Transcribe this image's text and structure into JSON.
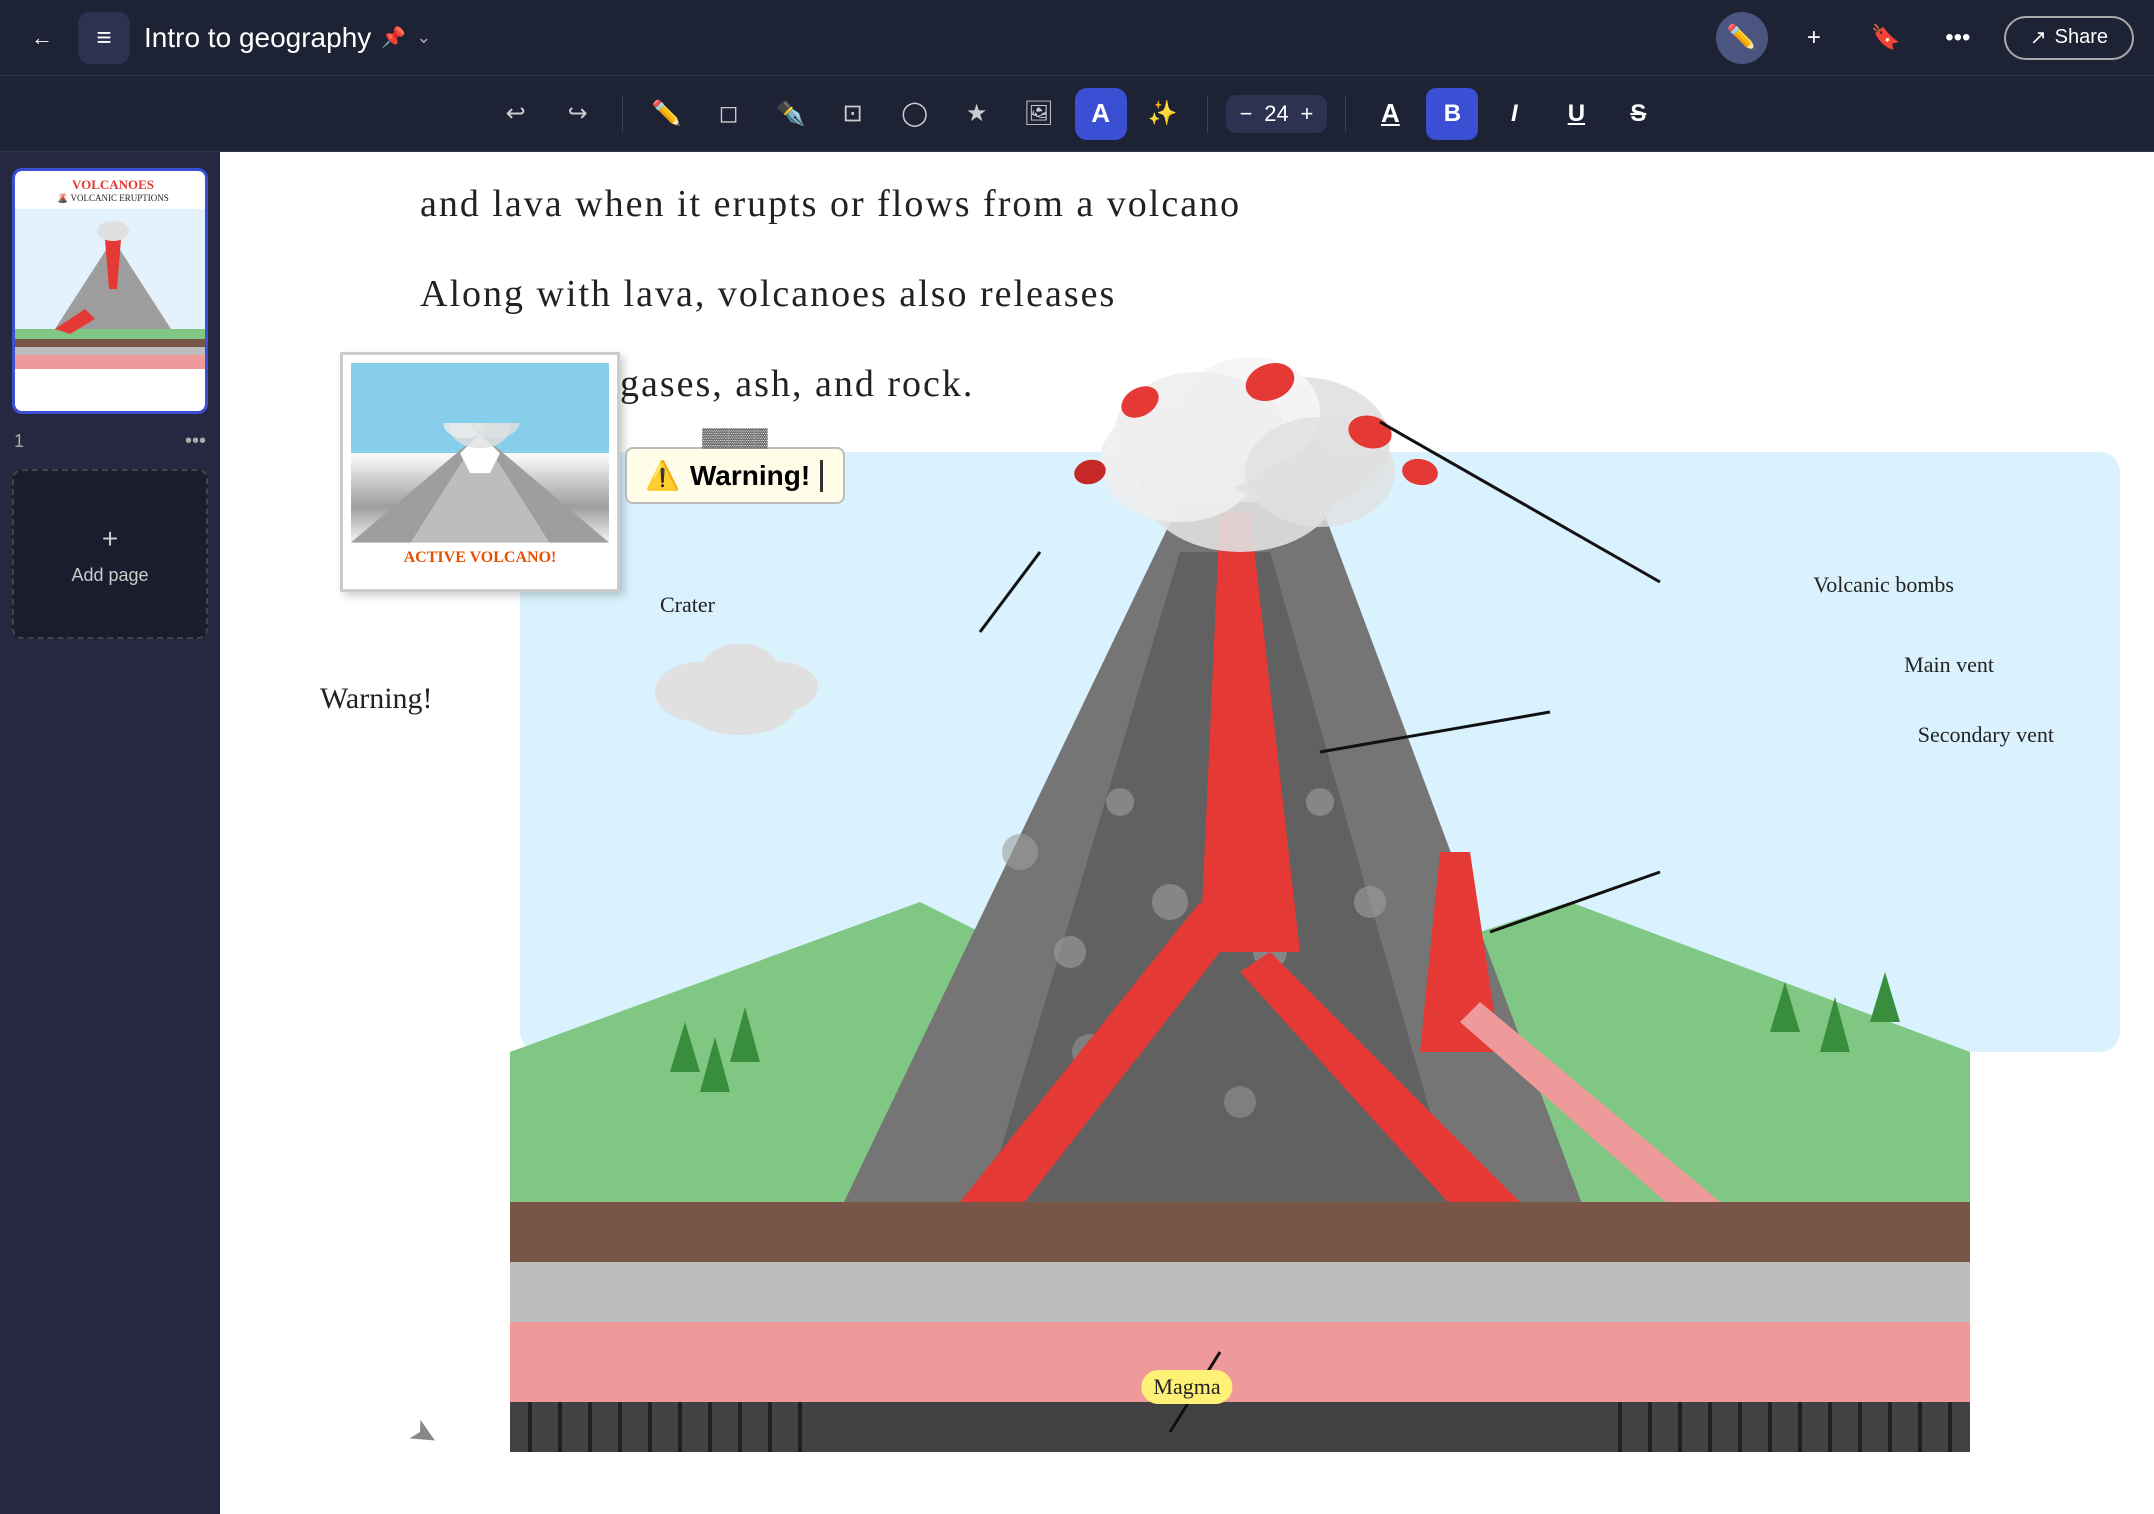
{
  "header": {
    "back_label": "←",
    "notebook_icon": "≡",
    "title": "Intro to geography",
    "pin_icon": "📌",
    "chevron_icon": "⌄",
    "btn_pen": "✏",
    "btn_add": "+",
    "btn_bookmark": "🔖",
    "btn_more": "•••",
    "share_icon": "↗",
    "share_label": "Share"
  },
  "toolbar": {
    "tools": [
      {
        "name": "undo",
        "icon": "↩",
        "active": false
      },
      {
        "name": "redo",
        "icon": "↪",
        "active": false
      },
      {
        "name": "pen",
        "icon": "✏",
        "active": false
      },
      {
        "name": "eraser",
        "icon": "⌫",
        "active": false
      },
      {
        "name": "pencil",
        "icon": "✒",
        "active": false
      },
      {
        "name": "selection",
        "icon": "⊡",
        "active": false
      },
      {
        "name": "lasso",
        "icon": "⊙",
        "active": false
      },
      {
        "name": "favorites",
        "icon": "★",
        "active": false
      },
      {
        "name": "image",
        "icon": "🖼",
        "active": false
      },
      {
        "name": "text",
        "icon": "T",
        "active": true
      },
      {
        "name": "magic",
        "icon": "✨",
        "active": false
      }
    ],
    "font_size": "24",
    "font_minus": "−",
    "font_plus": "+",
    "format_a": "A",
    "format_bold": "B",
    "format_italic": "I",
    "format_underline": "U",
    "format_strikethrough": "S"
  },
  "sidebar": {
    "page_number": "1",
    "more_icon": "•••",
    "add_page_label": "Add page",
    "plus_icon": "+"
  },
  "canvas": {
    "text_line1": "and lava  when it erupts or flows from a volcano",
    "text_line2": "Along with lava, volcanoes also releases",
    "text_line3": "gases, ash, and rock.",
    "warning_emoji": "⚠️",
    "warning_text": "Warning!",
    "warning_label_bottom": "Warning!",
    "label_volcanic_bombs": "Volcanic bombs",
    "label_crater": "Crater",
    "label_main_vent": "Main vent",
    "label_secondary_vent": "Secondary vent",
    "label_magma": "Magma",
    "active_volcano_caption": "ACTIVE VOLCANO!",
    "thumb_title": "VOLCANOES",
    "thumb_sub": "🌋 VOLCANIC ERUPTIONS"
  },
  "colors": {
    "header_bg": "#1e2235",
    "active_tool": "#3a4fd4",
    "warning_bg": "#fffde7",
    "magma_label_bg": "#fff176",
    "volcano_red": "#e53935",
    "volcano_gray": "#757575",
    "sky_blue": "#b3e5fc",
    "grass_green": "#81c784"
  }
}
